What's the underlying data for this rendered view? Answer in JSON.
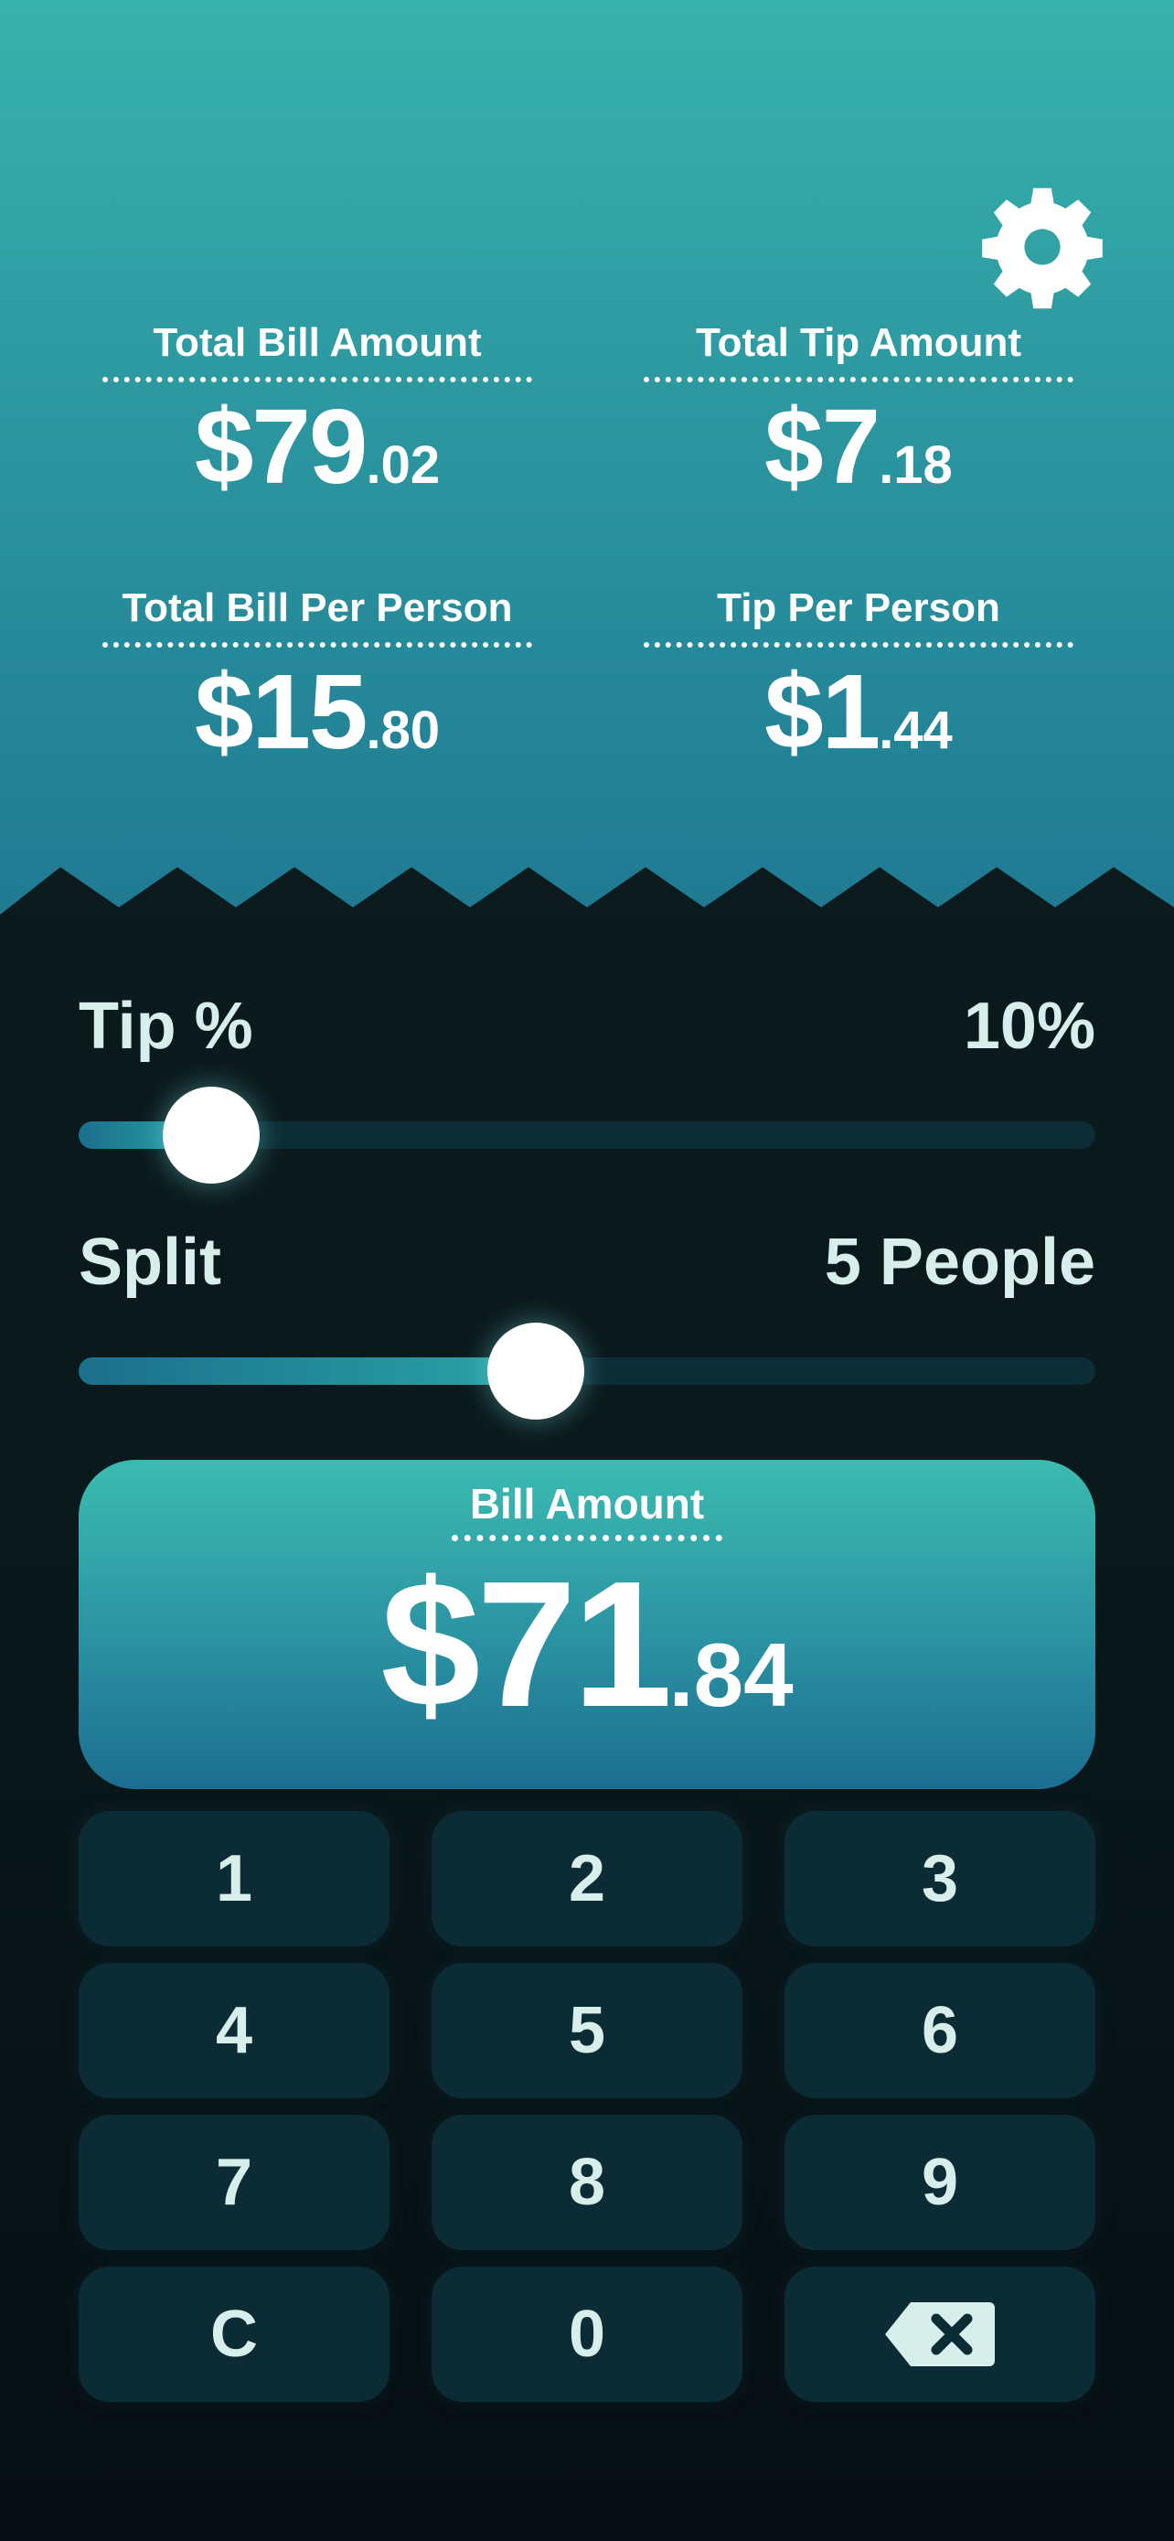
{
  "colors": {
    "accent": "#38b2ac",
    "header_bottom": "#1f7a92",
    "background": "#0b1b1e",
    "key_background": "#0b2b35",
    "text_light": "#dff1ef"
  },
  "header": {
    "settings_icon": "gear-icon",
    "stats": [
      {
        "label": "Total Bill Amount",
        "major": "$79",
        "minor": ".02"
      },
      {
        "label": "Total Tip Amount",
        "major": "$7",
        "minor": ".18"
      },
      {
        "label": "Total Bill Per Person",
        "major": "$15",
        "minor": ".80"
      },
      {
        "label": "Tip Per Person",
        "major": "$1",
        "minor": ".44"
      }
    ]
  },
  "tip": {
    "label": "Tip %",
    "value_text": "10%",
    "slider_fraction": 0.13
  },
  "split": {
    "label": "Split",
    "value_text": "5 People",
    "slider_fraction": 0.45
  },
  "bill": {
    "label": "Bill Amount",
    "major": "$71",
    "minor": ".84"
  },
  "keypad": {
    "keys": [
      "1",
      "2",
      "3",
      "4",
      "5",
      "6",
      "7",
      "8",
      "9",
      "C",
      "0"
    ],
    "backspace_icon": "backspace-icon"
  }
}
